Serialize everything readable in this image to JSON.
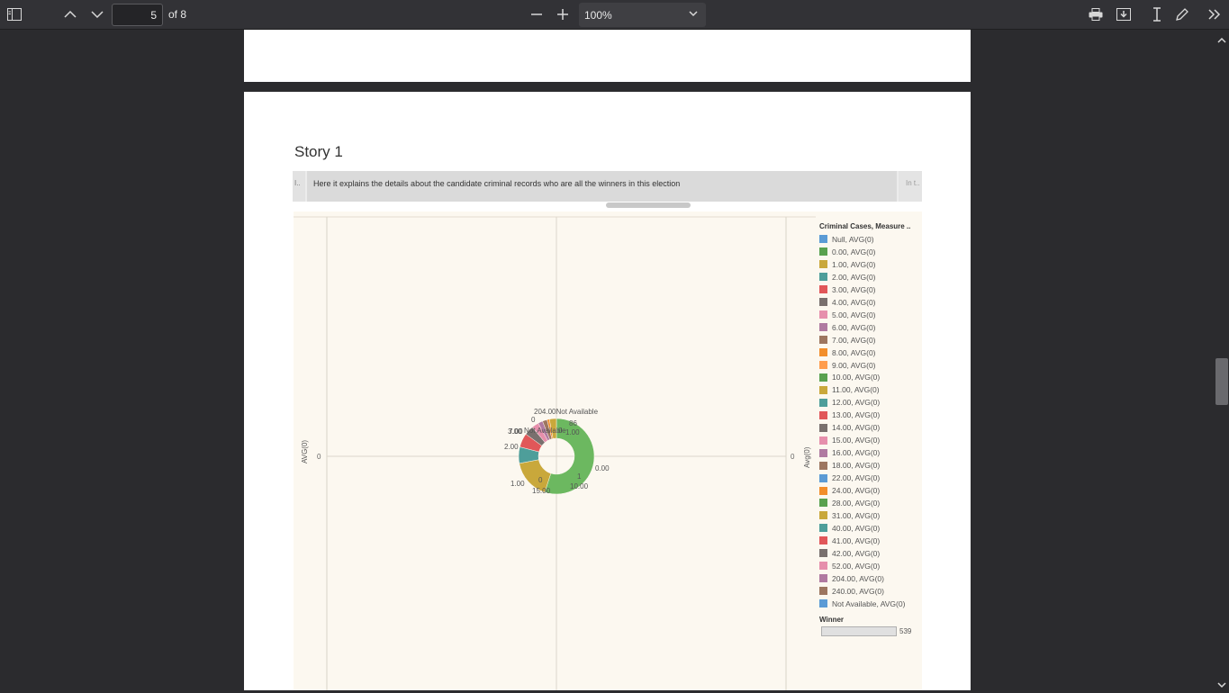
{
  "toolbar": {
    "page_current": "5",
    "page_of": "of 8",
    "zoom": "100%"
  },
  "story": {
    "title": "Story 1",
    "points": [
      {
        "label": "I.."
      },
      {
        "label": "Here it explains the details about the candidate criminal records who are all the winners in this election"
      },
      {
        "label": "In t.."
      }
    ]
  },
  "chart_data": {
    "type": "pie",
    "ylabel_left": "AVG(0)",
    "ylabel_right": "Avg(0)",
    "y_tick_left": "0",
    "y_tick_right": "0",
    "legend_title": "Criminal Cases, Measure ..",
    "legend": [
      {
        "label": "Null, AVG(0)",
        "color": "#5b9bd5"
      },
      {
        "label": "0.00, AVG(0)",
        "color": "#59a14f"
      },
      {
        "label": "1.00, AVG(0)",
        "color": "#c9a83b"
      },
      {
        "label": "2.00, AVG(0)",
        "color": "#4e9e9a"
      },
      {
        "label": "3.00, AVG(0)",
        "color": "#e15759"
      },
      {
        "label": "4.00, AVG(0)",
        "color": "#79706e"
      },
      {
        "label": "5.00, AVG(0)",
        "color": "#e68fac"
      },
      {
        "label": "6.00, AVG(0)",
        "color": "#b07aa1"
      },
      {
        "label": "7.00, AVG(0)",
        "color": "#9d7660"
      },
      {
        "label": "8.00, AVG(0)",
        "color": "#f28e2b"
      },
      {
        "label": "9.00, AVG(0)",
        "color": "#ff9d4d"
      },
      {
        "label": "10.00, AVG(0)",
        "color": "#59a14f"
      },
      {
        "label": "11.00, AVG(0)",
        "color": "#c9a83b"
      },
      {
        "label": "12.00, AVG(0)",
        "color": "#4e9e9a"
      },
      {
        "label": "13.00, AVG(0)",
        "color": "#e15759"
      },
      {
        "label": "14.00, AVG(0)",
        "color": "#79706e"
      },
      {
        "label": "15.00, AVG(0)",
        "color": "#e68fac"
      },
      {
        "label": "16.00, AVG(0)",
        "color": "#b07aa1"
      },
      {
        "label": "18.00, AVG(0)",
        "color": "#9d7660"
      },
      {
        "label": "22.00, AVG(0)",
        "color": "#5b9bd5"
      },
      {
        "label": "24.00, AVG(0)",
        "color": "#f28e2b"
      },
      {
        "label": "28.00, AVG(0)",
        "color": "#59a14f"
      },
      {
        "label": "31.00, AVG(0)",
        "color": "#c9a83b"
      },
      {
        "label": "40.00, AVG(0)",
        "color": "#4e9e9a"
      },
      {
        "label": "41.00, AVG(0)",
        "color": "#e15759"
      },
      {
        "label": "42.00, AVG(0)",
        "color": "#79706e"
      },
      {
        "label": "52.00, AVG(0)",
        "color": "#e68fac"
      },
      {
        "label": "204.00, AVG(0)",
        "color": "#b07aa1"
      },
      {
        "label": "240.00, AVG(0)",
        "color": "#9d7660"
      },
      {
        "label": "Not Available, AVG(0)",
        "color": "#5b9bd5"
      }
    ],
    "slices": [
      {
        "category": "0.00",
        "value": 55,
        "color": "#6cb860"
      },
      {
        "category": "1.00",
        "value": 17,
        "color": "#c9a83b"
      },
      {
        "category": "2.00",
        "value": 7,
        "color": "#4e9e9a"
      },
      {
        "category": "3.00",
        "value": 6,
        "color": "#e15759"
      },
      {
        "category": "4.00",
        "value": 4,
        "color": "#79706e"
      },
      {
        "category": "5.00",
        "value": 3,
        "color": "#e68fac"
      },
      {
        "category": "6.00",
        "value": 2,
        "color": "#b07aa1"
      },
      {
        "category": "7.00",
        "value": 2,
        "color": "#9d7660"
      },
      {
        "category": "8.00",
        "value": 1,
        "color": "#f28e2b"
      },
      {
        "category": "Not Available",
        "value": 3,
        "color": "#c9a83b"
      }
    ],
    "slice_labels": [
      "204.00Not Available",
      "0",
      "86",
      "1.00",
      "7.00",
      "3.00",
      "Not Available",
      "0",
      "2.00",
      "0.00",
      "1",
      "1.00",
      "0",
      "10.00",
      "15.00"
    ],
    "winner": {
      "title": "Winner",
      "value": "539"
    }
  }
}
